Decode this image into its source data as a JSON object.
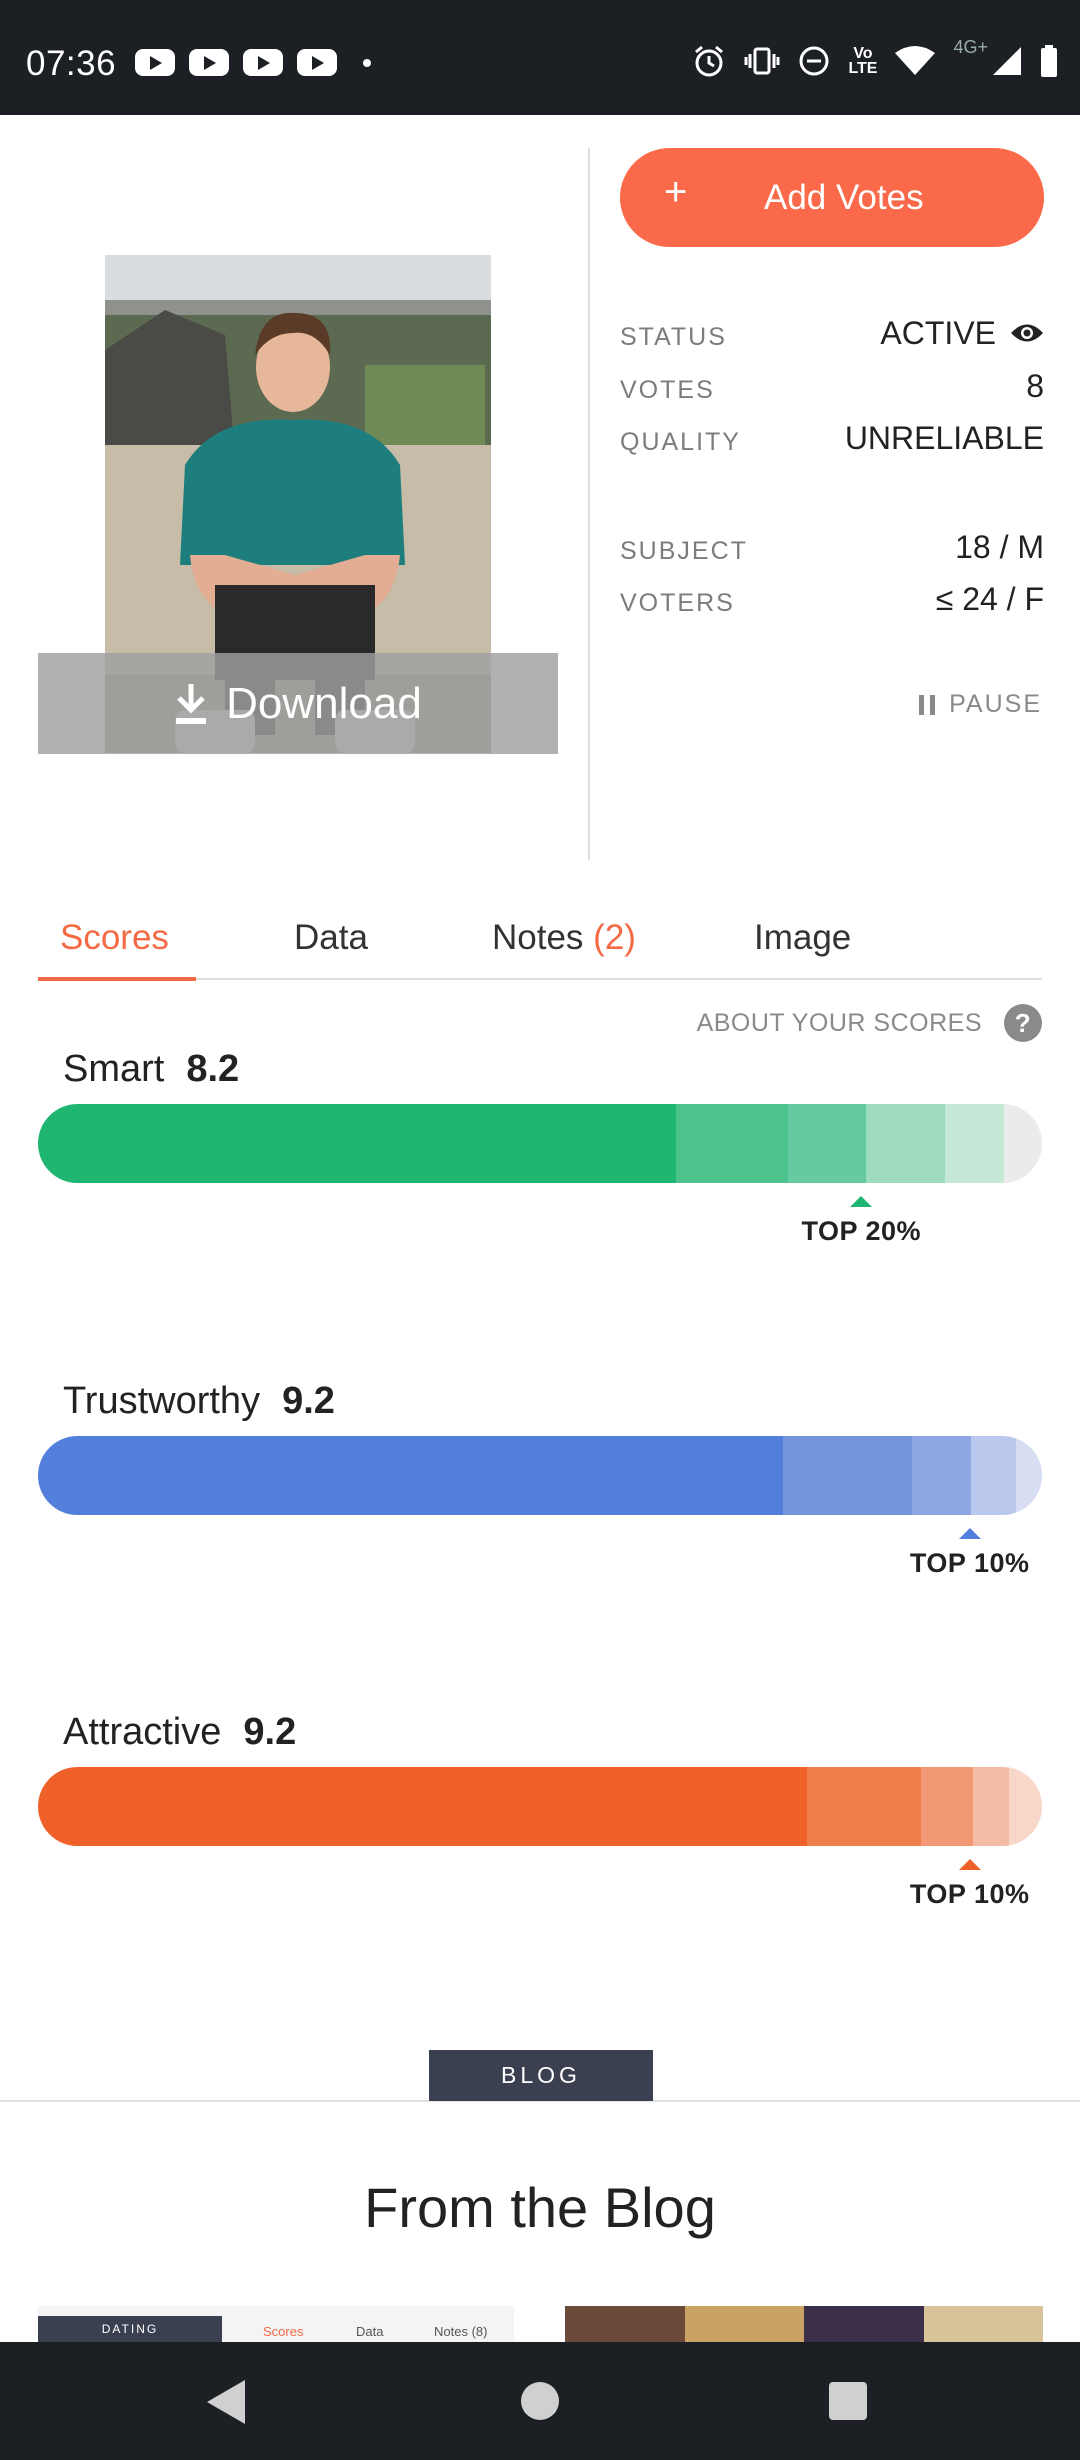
{
  "status_bar": {
    "time": "07:36",
    "left_icons": [
      "youtube-icon",
      "youtube-icon",
      "youtube-icon",
      "youtube-icon",
      "dot-icon"
    ],
    "right_icons": [
      "alarm-icon",
      "vibrate-icon",
      "dnd-icon",
      "volte-icon",
      "wifi-icon",
      "signal-icon",
      "battery-icon"
    ],
    "volte_label_1": "Vo",
    "volte_label_2": "LTE",
    "network": "4G+"
  },
  "photo": {
    "download_label": "Download"
  },
  "actions": {
    "add_votes_label": "Add Votes",
    "pause_label": "PAUSE"
  },
  "info": {
    "status_key": "STATUS",
    "status_value": "ACTIVE",
    "votes_key": "VOTES",
    "votes_value": "8",
    "quality_key": "QUALITY",
    "quality_value": "UNRELIABLE",
    "subject_key": "SUBJECT",
    "subject_value": "18 / M",
    "voters_key": "VOTERS",
    "voters_value": "≤ 24 / F"
  },
  "tabs": {
    "scores": "Scores",
    "data": "Data",
    "notes": "Notes",
    "notes_count": "(2)",
    "image": "Image"
  },
  "about_scores": "ABOUT YOUR SCORES",
  "scores": [
    {
      "label": "Smart",
      "value": "8.2",
      "rank": "TOP 20%",
      "percentile": 0.82,
      "color": "#1fb672",
      "segments": [
        0.635,
        0.112,
        0.078,
        0.078,
        0.059
      ],
      "seg_colors": [
        "#1fb672",
        "#4cc38c",
        "#66caa0",
        "#9fdcbd",
        "#c5e9d6"
      ]
    },
    {
      "label": "Trustworthy",
      "value": "9.2",
      "rank": "TOP 10%",
      "percentile": 0.928,
      "color": "#527fdb",
      "segments": [
        0.742,
        0.129,
        0.058,
        0.045,
        0.026
      ],
      "seg_colors": [
        "#527fdb",
        "#7494dc",
        "#8ea6e2",
        "#bbc8ee",
        "#d7def4"
      ]
    },
    {
      "label": "Attractive",
      "value": "9.2",
      "rank": "TOP 10%",
      "percentile": 0.928,
      "color": "#ef6128",
      "segments": [
        0.766,
        0.113,
        0.052,
        0.036,
        0.033
      ],
      "seg_colors": [
        "#ef6128",
        "#f07d4c",
        "#f29874",
        "#f5bca5",
        "#f8d6c8"
      ]
    }
  ],
  "blog": {
    "tag": "BLOG",
    "heading": "From the Blog",
    "thumb_tag": "DATING",
    "thumb_tabs": [
      "Scores",
      "Data",
      "Notes (8)"
    ]
  }
}
